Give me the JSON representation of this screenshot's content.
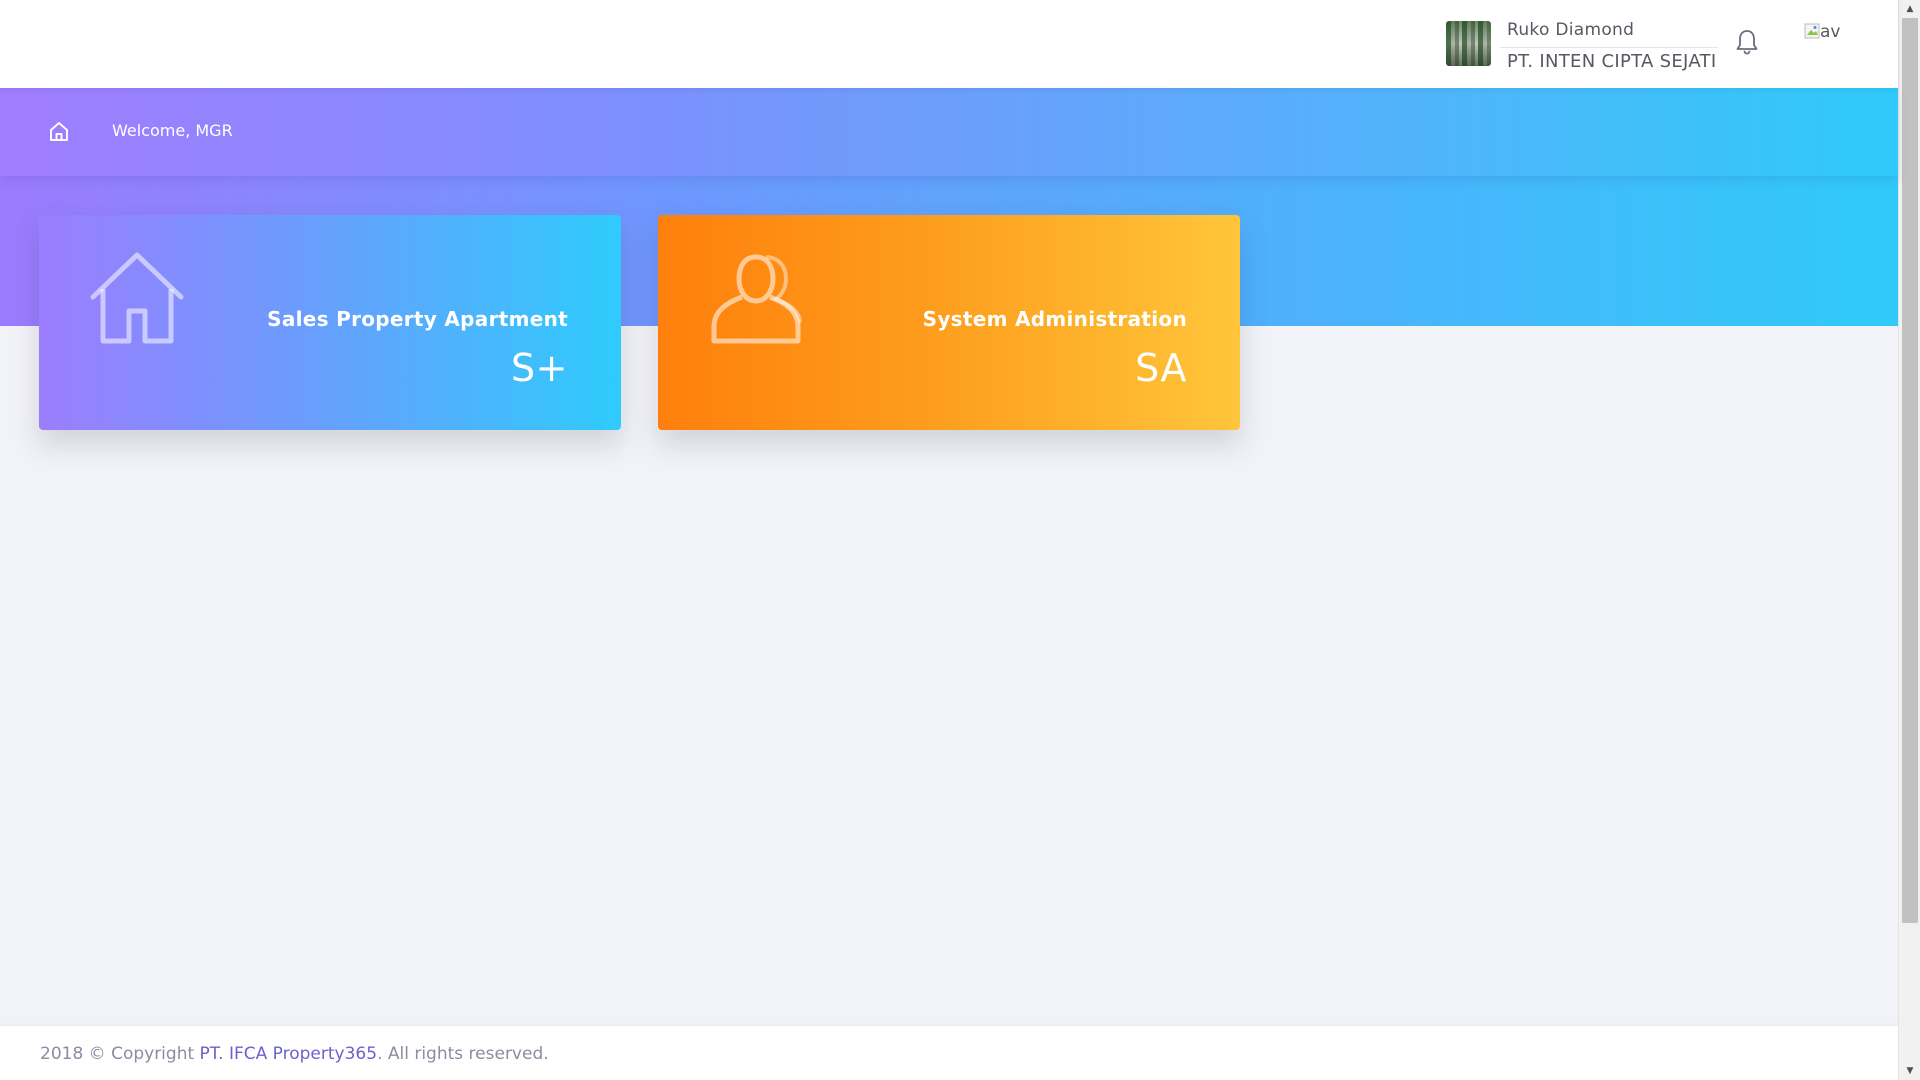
{
  "header": {
    "project_name": "Ruko Diamond",
    "company_name": "PT. INTEN CIPTA SEJATI",
    "bell_icon": "bell-icon",
    "avatar_alt": "av"
  },
  "subheader": {
    "home_icon": "home-icon",
    "welcome_text": "Welcome, MGR"
  },
  "cards": [
    {
      "title": "Sales Property Apartment",
      "code": "S+",
      "icon": "house-icon",
      "gradient": [
        "#9c7dfe",
        "#2fcbfc"
      ]
    },
    {
      "title": "System Administration",
      "code": "SA",
      "icon": "users-icon",
      "gradient": [
        "#ff7f0c",
        "#ffc53a"
      ]
    }
  ],
  "footer": {
    "prefix": "2018 © Copyright ",
    "link": "PT. IFCA Property365",
    "suffix": ". All rights reserved."
  },
  "colors": {
    "band_start": "#9b7bfd",
    "band_end": "#2fcafa",
    "background": "#f2f3f8",
    "link": "#6b62cc"
  }
}
